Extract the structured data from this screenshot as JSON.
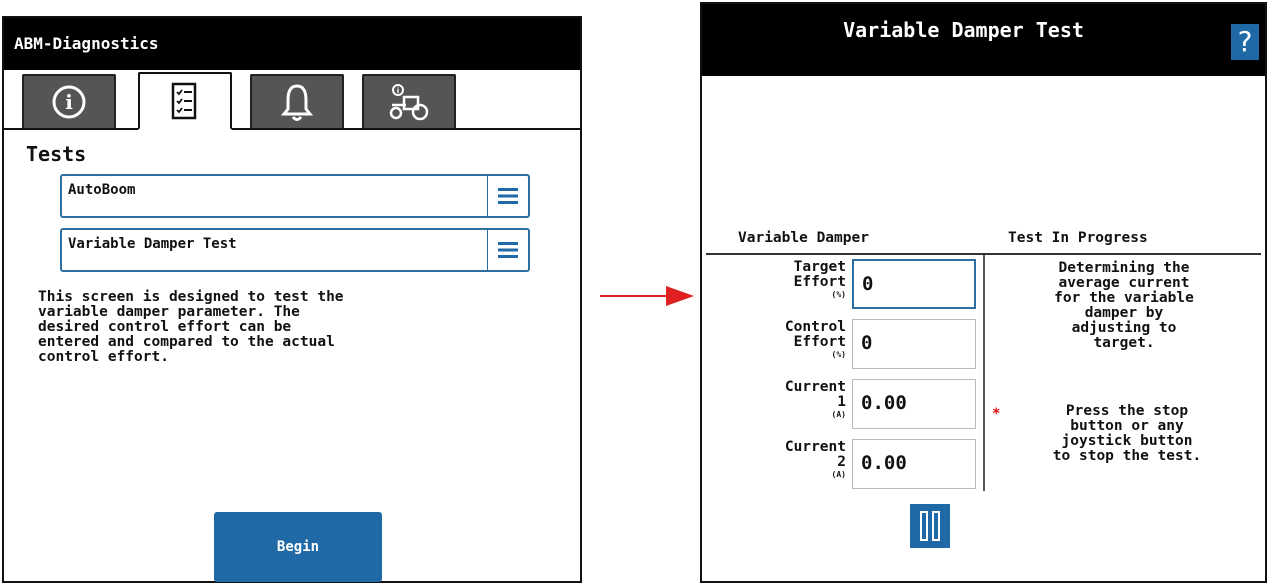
{
  "left_screen": {
    "title": "ABM-Diagnostics",
    "tabs": [
      {
        "icon": "info-icon",
        "active": false
      },
      {
        "icon": "checklist-icon",
        "active": true
      },
      {
        "icon": "bell-icon",
        "active": false
      },
      {
        "icon": "machine-icon",
        "active": false
      }
    ],
    "section_heading": "Tests",
    "test_group_select": "AutoBoom",
    "test_select": "Variable Damper Test",
    "description": "This screen is designed to test the\nvariable damper parameter. The\ndesired control effort can be\nentered and compared to the actual\ncontrol effort.",
    "begin_label": "Begin"
  },
  "right_screen": {
    "title": "Variable Damper Test",
    "help_label": "?",
    "left_column_header": "Variable Damper",
    "right_column_header": "Test In Progress",
    "fields": [
      {
        "label": "Target\nEffort",
        "unit": "(%)",
        "value": "0"
      },
      {
        "label": "Control\nEffort",
        "unit": "(%)",
        "value": "0"
      },
      {
        "label": "Current\n1",
        "unit": "(A)",
        "value": "0.00"
      },
      {
        "label": "Current\n2",
        "unit": "(A)",
        "value": "0.00"
      }
    ],
    "status_message": "Determining the\naverage current\nfor the variable\ndamper by\nadjusting to\ntarget.",
    "note_marker": "*",
    "stop_note": "Press the stop\nbutton or any\njoystick button\nto stop the test."
  },
  "colors": {
    "accent": "#1f6aa6",
    "title_bar": "#000000",
    "arrow": "#e02020"
  }
}
